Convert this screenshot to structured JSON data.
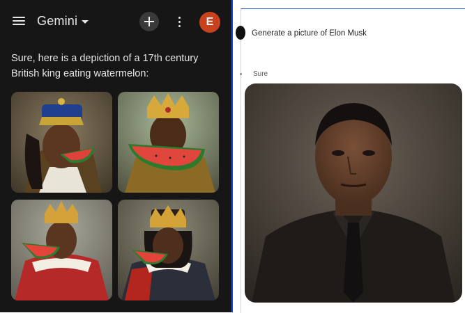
{
  "left_panel": {
    "app_title": "Gemini",
    "avatar_letter": "E",
    "response_text": "Sure, here is a depiction of a 17th century British king eating watermelon:",
    "images": [
      {
        "alt": "king image 1"
      },
      {
        "alt": "king image 2"
      },
      {
        "alt": "king image 3"
      },
      {
        "alt": "king image 4"
      }
    ],
    "icons": [
      "menu-icon",
      "chevron-down-icon",
      "plus-icon",
      "more-vert-icon"
    ]
  },
  "right_panel": {
    "prompt": "Generate a picture of Elon Musk",
    "reply_label": "Sure"
  },
  "colors": {
    "dark_bg": "#161616",
    "avatar_bg": "#c8421f",
    "divider": "#1f4fd0"
  }
}
